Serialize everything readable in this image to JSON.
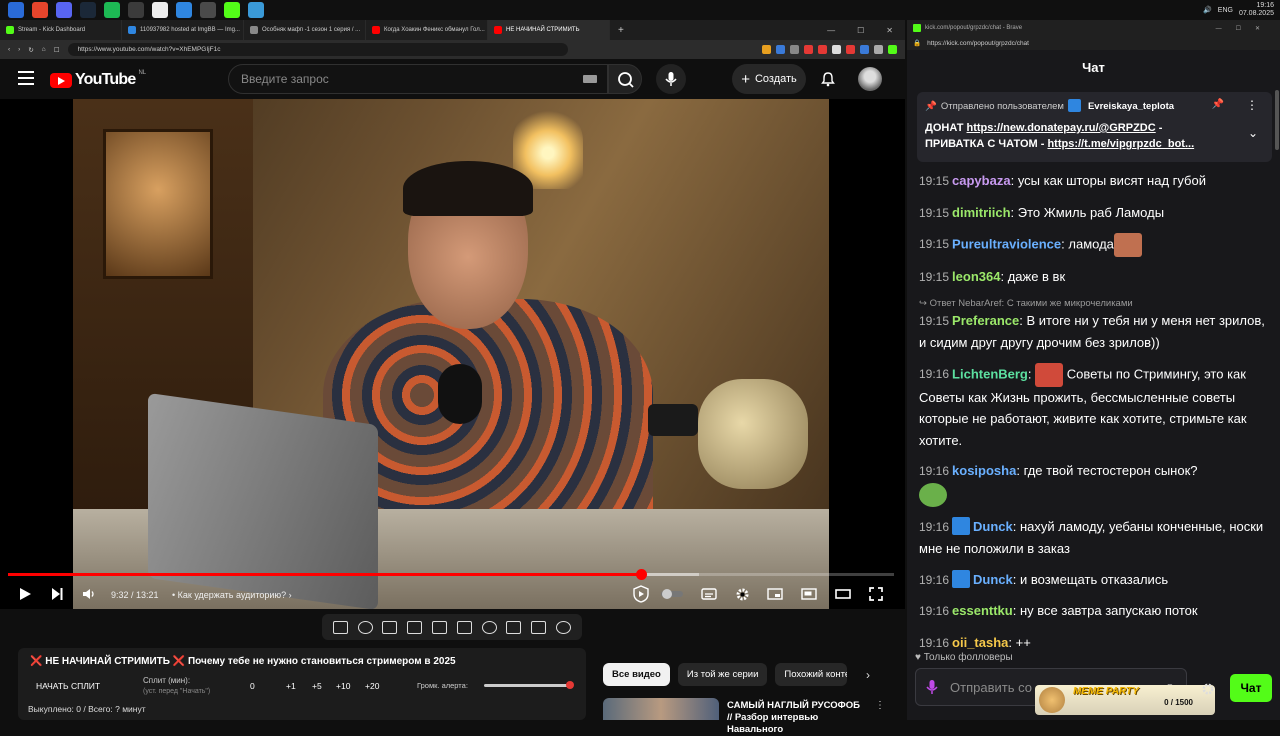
{
  "taskbar": {
    "clock_time": "19:16",
    "clock_date": "07.08.2025",
    "lang": "ENG",
    "icon_colors": [
      "#2a6bd8",
      "#e8452c",
      "#5865f2",
      "#1b2838",
      "#1db954",
      "#3b3b3b",
      "#ececec",
      "#2f86e0",
      "#4a4a4a",
      "#53fc18",
      "#3a9ad8"
    ]
  },
  "browser_left": {
    "tabs": [
      {
        "label": "Stream - Kick Dashboard",
        "fav": "#53fc18",
        "active": false
      },
      {
        "label": "110937982 hosted at ImgBB — Img...",
        "fav": "#2f86e0",
        "active": false
      },
      {
        "label": "Особняк мафп -1 сезон 1 серия / ...",
        "fav": "#8a8a8a",
        "active": false
      },
      {
        "label": "Когда Хоакин Феникс обманул Гол...",
        "fav": "#ff0000",
        "active": false
      },
      {
        "label": "НЕ НАЧИНАЙ СТРИМИТЬ",
        "fav": "#ff0000",
        "active": true
      }
    ],
    "url": "https://www.youtube.com/watch?v=XhEMPGIjF1c"
  },
  "youtube": {
    "logo_text": "YouTube",
    "logo_region": "NL",
    "search_placeholder": "Введите запрос",
    "create_label": "Создать",
    "player": {
      "time": "9:32 / 13:21",
      "chapter": "• Как удержать аудиторию?",
      "progress_fraction": 0.714,
      "buffer_fraction": 0.78
    },
    "split": {
      "title": "❌ НЕ НАЧИНАЙ СТРИМИТЬ ❌ Почему тебе не нужно становиться стримером в 2025",
      "start_label": "НАЧАТЬ СПЛИТ",
      "split_label": "Сплит (мин):",
      "split_hint": "(уст. перед \"Начать\")",
      "values": [
        "0",
        "+1",
        "+5",
        "+10",
        "+20"
      ],
      "alert_label": "Громк. алерта:",
      "alert_fraction": 1.0,
      "bought": "Выкуплено: 0 / Всего: ? минут"
    },
    "chips": [
      "Все видео",
      "Из той же серии",
      "Похожий конте"
    ],
    "reco_title": "САМЫЙ НАГЛЫЙ РУСОФОБ // Разбор интервью Навального"
  },
  "browser_right": {
    "title": "kick.com/popout/grpzdc/chat - Brave",
    "url": "https://kick.com/popout/grpzdc/chat"
  },
  "chat": {
    "header": "Чат",
    "pinned_by_label": "Отправлено пользователем",
    "pinned_user": "Evreiskaya_teplota",
    "pinned_line1_prefix": "ДОНАТ ",
    "pinned_link1": "https://new.donatepay.ru/@GRPZDC",
    "pinned_line1_suffix": " -",
    "pinned_line2_prefix": "ПРИВАТКА С ЧАТОМ - ",
    "pinned_link2": "https://t.me/vipgrpzdc_bot...",
    "messages": [
      {
        "ts": "19:15",
        "user": "capybaza",
        "color": "#c89af0",
        "text": "усы как шторы висят над губой"
      },
      {
        "ts": "19:15",
        "user": "dimitriich",
        "color": "#9be86a",
        "text": "Это Жмиль раб Ламоды"
      },
      {
        "ts": "19:15",
        "user": "Pureultraviolence",
        "color": "#6ab0ff",
        "text": "ламода"
      },
      {
        "ts": "19:15",
        "user": "leon364",
        "color": "#9be86a",
        "text": "даже в вк"
      },
      {
        "reply": "Ответ NebarAref: С такими же микрочеликами",
        "ts": "19:15",
        "user": "Preferance",
        "color": "#9be86a",
        "text": "В итоге ни у тебя ни у меня нет зрилов, и сидим друг другу дрочим без зрилов))"
      },
      {
        "ts": "19:16",
        "user": "LichtenBerg",
        "color": "#5ce0a0",
        "text": "Советы по Стримингу, это как Советы как Жизнь прожить, бессмысленные советы которые не работают, живите как хотите, стримьте как хотите."
      },
      {
        "ts": "19:16",
        "user": "kosiposha",
        "color": "#6ab0ff",
        "text": "где твой тестостерон сынок?"
      },
      {
        "ts": "19:16",
        "user": "Dunck",
        "color": "#6ab0ff",
        "text": "нахуй ламоду, уебаны конченные, носки мне не положили в заказ"
      },
      {
        "ts": "19:16",
        "user": "Dunck",
        "color": "#6ab0ff",
        "text": "и возмещать отказались"
      },
      {
        "ts": "19:16",
        "user": "essenttku",
        "color": "#9be86a",
        "text": "ну все завтра запускаю поток"
      },
      {
        "ts": "19:16",
        "user": "oii_tasha",
        "color": "#f5c84a",
        "text": "++"
      }
    ],
    "followers_only": "Только фолловеры",
    "input_placeholder": "Отправить со",
    "meme_party_title": "MEME PARTY",
    "meme_party_count": "0 / 1500",
    "send_label": "Чат",
    "accent": "#53fc18"
  }
}
